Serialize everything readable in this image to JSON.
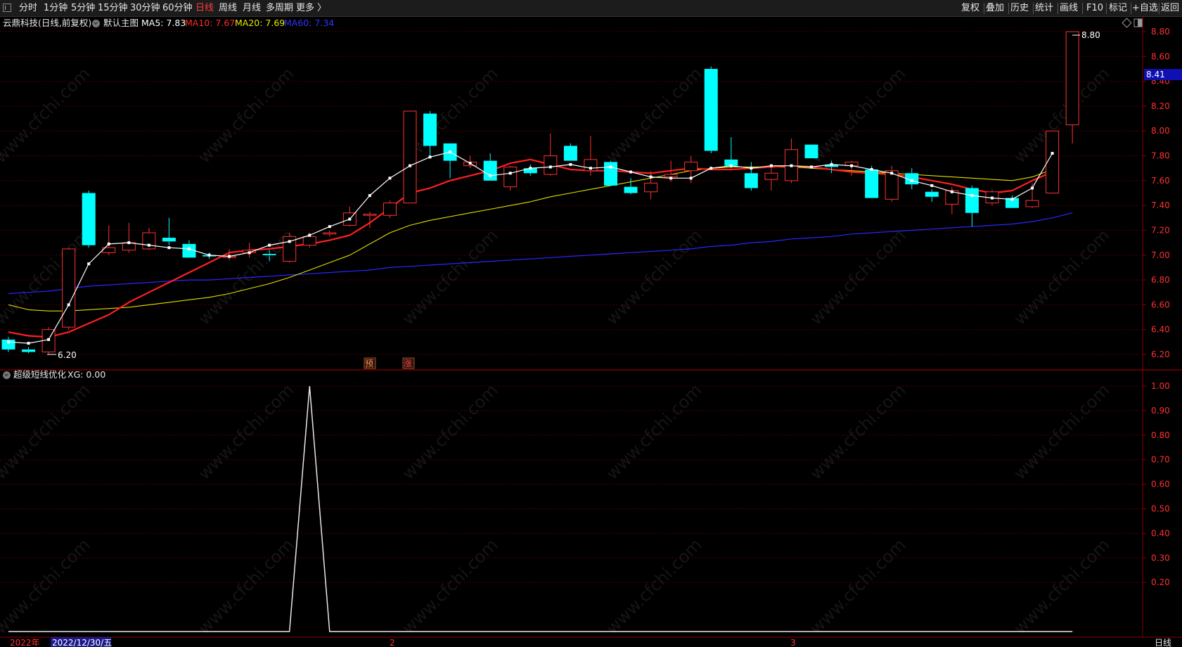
{
  "toolbar": {
    "periods": [
      "分时",
      "1分钟",
      "5分钟",
      "15分钟",
      "30分钟",
      "60分钟",
      "日线",
      "周线",
      "月线",
      "多周期",
      "更多 〉"
    ],
    "active_period": "日线",
    "right_buttons": [
      "复权",
      "叠加",
      "历史",
      "统计",
      "画线",
      "F10",
      "标记",
      "+自选",
      "返回"
    ]
  },
  "main_header": {
    "title": "云鼎科技(日线,前复权)",
    "template": "默认主图",
    "ma5": "MA5: 7.83",
    "ma10": "MA10: 7.67",
    "ma20": "MA20: 7.69",
    "ma60": "MA60: 7.34"
  },
  "sub_header": {
    "title": "超级短线优化",
    "value": "XG: 0.00"
  },
  "labels": {
    "high_marker": "8.80",
    "low_marker": "6.20",
    "current_price": "8.41",
    "signal_1": "预",
    "signal_2": "涨"
  },
  "xaxis": {
    "year": "2022年",
    "cursor_date": "2022/12/30/五",
    "month_2": "2",
    "month_3": "3",
    "period_label": "日线"
  },
  "watermark": "www.cfchi.com",
  "colors": {
    "up": "#ff3232",
    "down": "#00ffff",
    "ma5": "#ffffff",
    "ma10": "#ff2020",
    "ma20": "#e0e000",
    "ma60": "#2828ff",
    "grid": "#8b0000",
    "axis_text": "#ff3030",
    "active": "#ff3b3b"
  },
  "chart_data": [
    {
      "type": "candlestick",
      "title": "云鼎科技(日线,前复权)",
      "ylim": [
        6.1,
        8.9
      ],
      "yticks": [
        6.2,
        6.4,
        6.6,
        6.8,
        7.0,
        7.2,
        7.4,
        7.6,
        7.8,
        8.0,
        8.2,
        8.4,
        8.6,
        8.8
      ],
      "ohlc": [
        [
          6.32,
          6.34,
          6.22,
          6.24
        ],
        [
          6.24,
          6.26,
          6.21,
          6.22
        ],
        [
          6.22,
          6.42,
          6.2,
          6.4
        ],
        [
          6.42,
          7.06,
          6.4,
          7.05
        ],
        [
          7.5,
          7.52,
          7.06,
          7.08
        ],
        [
          7.02,
          7.24,
          7.0,
          7.06
        ],
        [
          7.04,
          7.26,
          7.02,
          7.1
        ],
        [
          7.05,
          7.22,
          7.04,
          7.18
        ],
        [
          7.14,
          7.3,
          7.08,
          7.11
        ],
        [
          7.09,
          7.12,
          6.98,
          6.98
        ],
        [
          7.0,
          7.02,
          6.97,
          6.99
        ],
        [
          6.98,
          7.05,
          6.96,
          6.99
        ],
        [
          7.02,
          7.1,
          6.98,
          7.04
        ],
        [
          7.01,
          7.04,
          6.95,
          7.0
        ],
        [
          6.95,
          7.18,
          6.94,
          7.15
        ],
        [
          7.08,
          7.18,
          7.06,
          7.15
        ],
        [
          7.17,
          7.2,
          7.15,
          7.18
        ],
        [
          7.24,
          7.39,
          7.23,
          7.34
        ],
        [
          7.32,
          7.35,
          7.22,
          7.33
        ],
        [
          7.32,
          7.44,
          7.3,
          7.42
        ],
        [
          7.42,
          8.16,
          7.42,
          8.16
        ],
        [
          8.14,
          8.16,
          7.78,
          7.88
        ],
        [
          7.9,
          7.9,
          7.62,
          7.76
        ],
        [
          7.72,
          7.8,
          7.7,
          7.75
        ],
        [
          7.76,
          7.82,
          7.6,
          7.6
        ],
        [
          7.55,
          7.72,
          7.52,
          7.71
        ],
        [
          7.7,
          7.73,
          7.64,
          7.66
        ],
        [
          7.65,
          7.98,
          7.64,
          7.8
        ],
        [
          7.88,
          7.9,
          7.76,
          7.76
        ],
        [
          7.68,
          7.96,
          7.64,
          7.77
        ],
        [
          7.75,
          7.76,
          7.56,
          7.56
        ],
        [
          7.55,
          7.62,
          7.49,
          7.5
        ],
        [
          7.51,
          7.68,
          7.45,
          7.58
        ],
        [
          7.63,
          7.76,
          7.59,
          7.65
        ],
        [
          7.68,
          7.8,
          7.58,
          7.75
        ],
        [
          8.5,
          8.52,
          7.82,
          7.84
        ],
        [
          7.77,
          7.95,
          7.7,
          7.72
        ],
        [
          7.66,
          7.75,
          7.52,
          7.54
        ],
        [
          7.61,
          7.7,
          7.52,
          7.66
        ],
        [
          7.6,
          7.94,
          7.58,
          7.85
        ],
        [
          7.89,
          7.89,
          7.78,
          7.78
        ],
        [
          7.73,
          7.76,
          7.66,
          7.71
        ],
        [
          7.72,
          7.76,
          7.64,
          7.75
        ],
        [
          7.69,
          7.72,
          7.46,
          7.46
        ],
        [
          7.45,
          7.72,
          7.43,
          7.68
        ],
        [
          7.66,
          7.7,
          7.53,
          7.57
        ],
        [
          7.51,
          7.53,
          7.43,
          7.47
        ],
        [
          7.41,
          7.55,
          7.33,
          7.52
        ],
        [
          7.54,
          7.56,
          7.23,
          7.34
        ],
        [
          7.42,
          7.53,
          7.4,
          7.51
        ],
        [
          7.46,
          7.48,
          7.38,
          7.38
        ],
        [
          7.39,
          7.58,
          7.38,
          7.44
        ],
        [
          7.5,
          8.0,
          7.5,
          8.0
        ],
        [
          8.05,
          8.8,
          7.9,
          8.8
        ]
      ],
      "ma5": [
        6.3,
        6.29,
        6.32,
        6.6,
        6.93,
        7.09,
        7.1,
        7.08,
        7.06,
        7.05,
        7.0,
        6.99,
        7.02,
        7.08,
        7.11,
        7.16,
        7.23,
        7.29,
        7.48,
        7.62,
        7.72,
        7.79,
        7.83,
        7.74,
        7.64,
        7.66,
        7.7,
        7.71,
        7.73,
        7.7,
        7.71,
        7.67,
        7.63,
        7.62,
        7.62,
        7.7,
        7.72,
        7.7,
        7.72,
        7.72,
        7.71,
        7.73,
        7.72,
        7.69,
        7.66,
        7.6,
        7.56,
        7.51,
        7.48,
        7.46,
        7.45,
        7.54,
        7.82
      ],
      "ma10": [
        6.38,
        6.35,
        6.34,
        6.38,
        6.45,
        6.52,
        6.62,
        6.7,
        6.78,
        6.86,
        6.94,
        7.02,
        7.04,
        7.05,
        7.07,
        7.09,
        7.12,
        7.16,
        7.26,
        7.38,
        7.5,
        7.54,
        7.6,
        7.64,
        7.68,
        7.74,
        7.77,
        7.73,
        7.69,
        7.68,
        7.68,
        7.67,
        7.66,
        7.68,
        7.7,
        7.69,
        7.69,
        7.7,
        7.71,
        7.72,
        7.71,
        7.69,
        7.67,
        7.66,
        7.65,
        7.63,
        7.6,
        7.57,
        7.53,
        7.5,
        7.52,
        7.6,
        7.67
      ],
      "ma20": [
        6.6,
        6.56,
        6.55,
        6.55,
        6.56,
        6.57,
        6.58,
        6.6,
        6.62,
        6.64,
        6.66,
        6.69,
        6.73,
        6.77,
        6.82,
        6.88,
        6.94,
        7.0,
        7.09,
        7.18,
        7.24,
        7.28,
        7.31,
        7.34,
        7.37,
        7.4,
        7.43,
        7.47,
        7.5,
        7.53,
        7.56,
        7.59,
        7.62,
        7.65,
        7.68,
        7.7,
        7.71,
        7.71,
        7.71,
        7.71,
        7.7,
        7.69,
        7.68,
        7.67,
        7.66,
        7.65,
        7.64,
        7.63,
        7.62,
        7.61,
        7.6,
        7.63,
        7.69
      ],
      "ma60": [
        6.69,
        6.7,
        6.71,
        6.73,
        6.75,
        6.76,
        6.77,
        6.78,
        6.79,
        6.8,
        6.8,
        6.81,
        6.82,
        6.83,
        6.84,
        6.85,
        6.86,
        6.87,
        6.88,
        6.9,
        6.91,
        6.92,
        6.93,
        6.94,
        6.95,
        6.96,
        6.97,
        6.98,
        6.99,
        7.0,
        7.01,
        7.02,
        7.03,
        7.04,
        7.05,
        7.07,
        7.08,
        7.1,
        7.11,
        7.13,
        7.14,
        7.15,
        7.17,
        7.18,
        7.19,
        7.2,
        7.21,
        7.22,
        7.23,
        7.24,
        7.25,
        7.27,
        7.3,
        7.34
      ]
    },
    {
      "type": "line",
      "title": "超级短线优化",
      "series": [
        {
          "name": "XG",
          "values": [
            0,
            0,
            0,
            0,
            0,
            0,
            0,
            0,
            0,
            0,
            0,
            0,
            0,
            0,
            0,
            1,
            0,
            0,
            0,
            0,
            0,
            0,
            0,
            0,
            0,
            0,
            0,
            0,
            0,
            0,
            0,
            0,
            0,
            0,
            0,
            0,
            0,
            0,
            0,
            0,
            0,
            0,
            0,
            0,
            0,
            0,
            0,
            0,
            0,
            0,
            0,
            0,
            0,
            0
          ]
        }
      ],
      "ylim": [
        -0.02,
        1.05
      ],
      "yticks": [
        0.2,
        0.3,
        0.4,
        0.5,
        0.6,
        0.7,
        0.8,
        0.9,
        1.0
      ]
    }
  ]
}
